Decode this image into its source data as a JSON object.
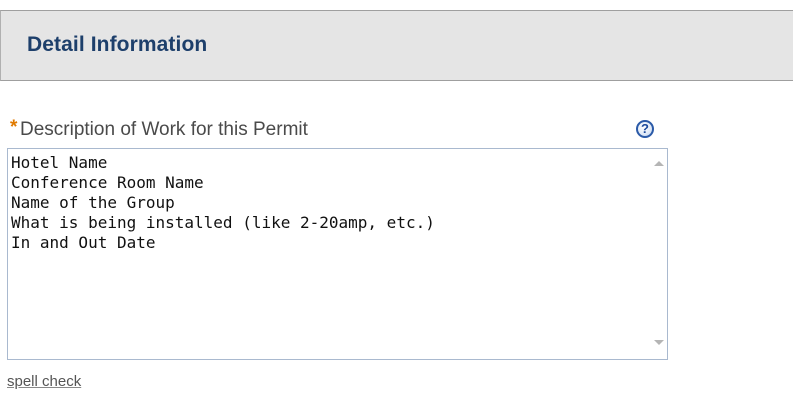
{
  "section": {
    "title": "Detail Information"
  },
  "field": {
    "required_marker": "*",
    "label": "Description of Work for this Permit",
    "help_icon": "help-icon",
    "value_lines": [
      "Hotel Name",
      "Conference Room Name",
      "Name of the Group",
      "What is being installed (like 2-20amp, etc.)",
      "In and Out Date"
    ]
  },
  "links": {
    "spell_check": "spell check"
  },
  "colors": {
    "title": "#1d3f6b",
    "required_marker": "#e07a00",
    "header_bg": "#e5e5e5",
    "help_icon": "#2b5aa8"
  }
}
